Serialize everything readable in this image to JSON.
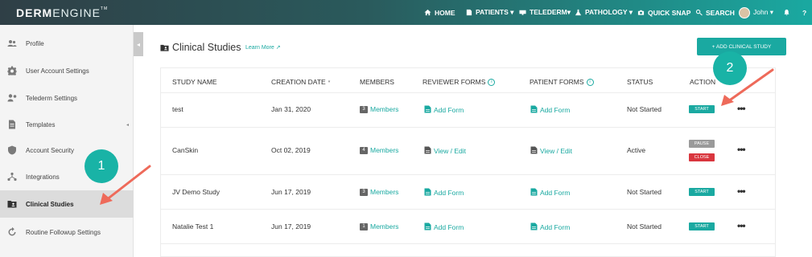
{
  "header": {
    "logo_bold": "DERM",
    "logo_light": "ENGINE",
    "logo_tm": "TM",
    "nav": [
      {
        "label": "HOME",
        "icon": "home-icon"
      },
      {
        "label": "PATIENTS ▾",
        "icon": "patients-icon"
      },
      {
        "label": "TELEDERM▾",
        "icon": "telederm-icon"
      },
      {
        "label": "PATHOLOGY ▾",
        "icon": "pathology-icon"
      },
      {
        "label": "QUICK SNAP",
        "icon": "camera-icon"
      },
      {
        "label": "SEARCH",
        "icon": "search-icon"
      }
    ],
    "user": "John ▾",
    "bell_icon": "bell-icon",
    "help": "?"
  },
  "sidebar": {
    "items": [
      {
        "label": "Profile",
        "icon": "people-icon"
      },
      {
        "label": "User Account Settings",
        "icon": "gear-icon"
      },
      {
        "label": "Telederm Settings",
        "icon": "telederm-settings-icon"
      },
      {
        "label": "Templates",
        "icon": "document-icon"
      },
      {
        "label": "Account Security",
        "icon": "shield-icon"
      },
      {
        "label": "Integrations",
        "icon": "network-icon"
      },
      {
        "label": "Clinical Studies",
        "icon": "folder-person-icon"
      },
      {
        "label": "Routine Followup Settings",
        "icon": "refresh-icon"
      }
    ],
    "templates_caret": "◂",
    "collapse": "◂"
  },
  "main": {
    "title": "Clinical Studies",
    "learn_more": "Learn More",
    "add_button": "+ ADD CLINICAL STUDY",
    "columns": [
      "STUDY NAME",
      "CREATION DATE",
      "MEMBERS",
      "REVIEWER FORMS",
      "PATIENT FORMS",
      "STATUS",
      "ACTION"
    ],
    "sort_caret": "▾",
    "info_glyph": "i",
    "rows": [
      {
        "name": "test",
        "date": "Jan 31, 2020",
        "members_count": "3",
        "members_label": "Members",
        "reviewer_form": "Add Form",
        "patient_form": "Add Form",
        "status": "Not Started",
        "actions": [
          "START"
        ]
      },
      {
        "name": "CanSkin",
        "date": "Oct 02, 2019",
        "members_count": "4",
        "members_label": "Members",
        "reviewer_form": "View / Edit",
        "patient_form": "View / Edit",
        "status": "Active",
        "actions": [
          "PAUSE",
          "CLOSE"
        ]
      },
      {
        "name": "JV Demo Study",
        "date": "Jun 17, 2019",
        "members_count": "3",
        "members_label": "Members",
        "reviewer_form": "Add Form",
        "patient_form": "Add Form",
        "status": "Not Started",
        "actions": [
          "START"
        ]
      },
      {
        "name": "Natalie Test 1",
        "date": "Jun 17, 2019",
        "members_count": "1",
        "members_label": "Members",
        "reviewer_form": "Add Form",
        "patient_form": "Add Form",
        "status": "Not Started",
        "actions": [
          "START"
        ]
      }
    ],
    "more_glyph": "•••"
  },
  "annotations": {
    "badge_1": "1",
    "badge_2": "2",
    "arrow_color": "#ee6a5a",
    "badge_color": "#19b3a6"
  },
  "colors": {
    "accent": "#1aa9a1",
    "danger": "#d9363e"
  }
}
